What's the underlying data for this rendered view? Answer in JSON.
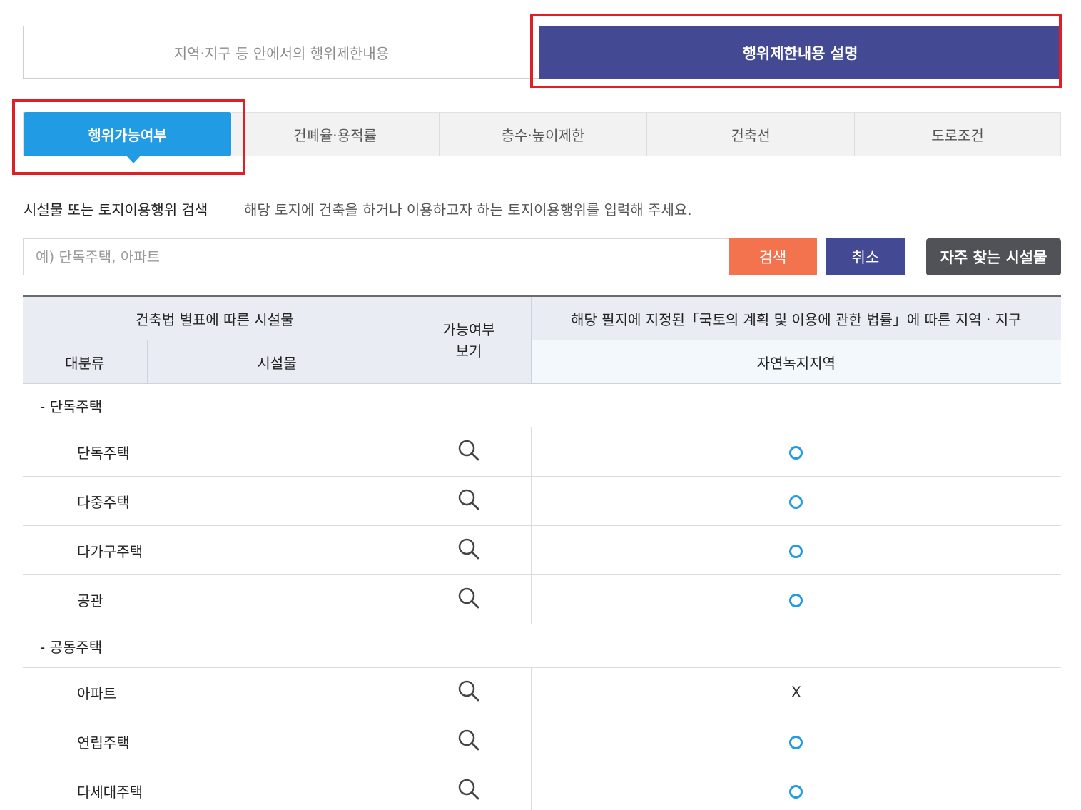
{
  "top_tabs": {
    "left": "지역·지구 등 안에서의 행위제한내용",
    "right": "행위제한내용 설명"
  },
  "sub_tabs": [
    "행위가능여부",
    "건폐율·용적률",
    "층수·높이제한",
    "건축선",
    "도로조건"
  ],
  "search": {
    "label": "시설물 또는 토지이용행위 검색",
    "help": "해당 토지에 건축을 하거나 이용하고자 하는 토지이용행위를 입력해 주세요.",
    "placeholder": "예) 단독주택, 아파트",
    "search_button": "검색",
    "cancel_button": "취소",
    "frequent_button": "자주 찾는 시설물"
  },
  "table": {
    "header_facility": "건축법 별표에 따른 시설물",
    "header_possible": "가능여부\n보기",
    "header_zone": "해당 필지에 지정된「국토의 계획 및 이용에 관한 법률」에 따른 지역 · 지구",
    "header_category": "대분류",
    "header_item": "시설물",
    "header_zone_name": "자연녹지지역",
    "groups": [
      {
        "category": "- 단독주택",
        "items": [
          {
            "name": "단독주택",
            "result": "O"
          },
          {
            "name": "다중주택",
            "result": "O"
          },
          {
            "name": "다가구주택",
            "result": "O"
          },
          {
            "name": "공관",
            "result": "O"
          }
        ]
      },
      {
        "category": "- 공동주택",
        "items": [
          {
            "name": "아파트",
            "result": "X"
          },
          {
            "name": "연립주택",
            "result": "O"
          },
          {
            "name": "다세대주택",
            "result": "O"
          }
        ]
      }
    ]
  }
}
